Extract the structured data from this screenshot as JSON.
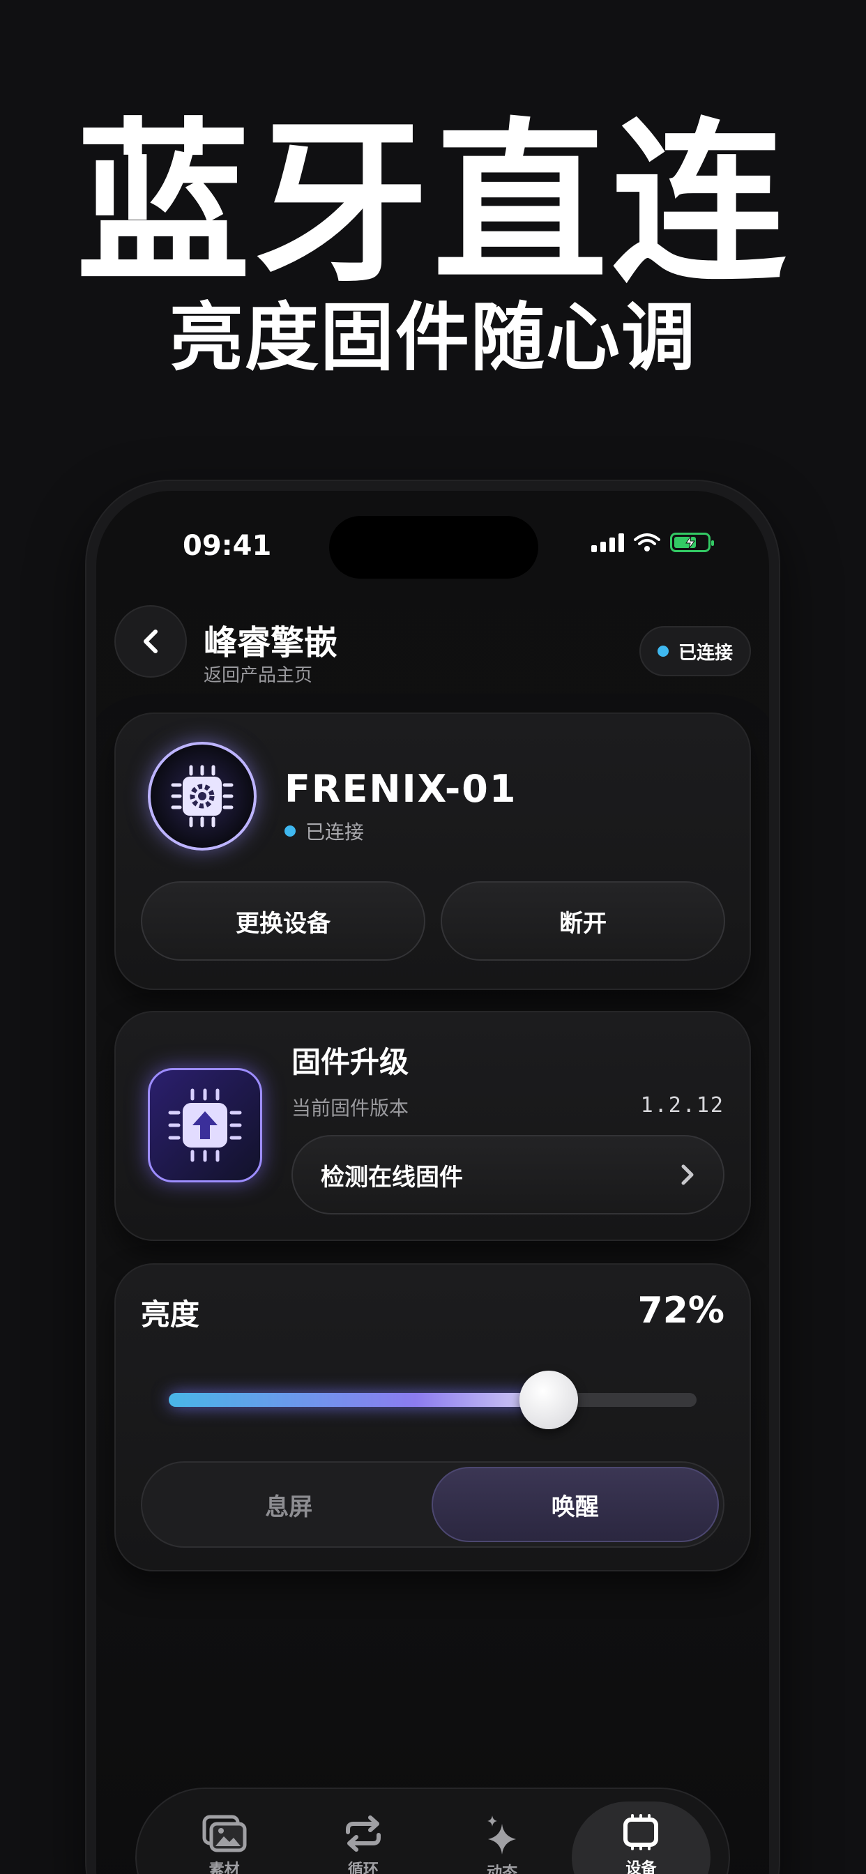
{
  "hero": {
    "title": "蓝牙直连",
    "subtitle": "亮度固件随心调"
  },
  "status_bar": {
    "time": "09:41"
  },
  "header": {
    "title": "峰睿擎嵌",
    "subtitle": "返回产品主页",
    "status": "已连接"
  },
  "device": {
    "name": "FRENIX-01",
    "status": "已连接",
    "switch_label": "更换设备",
    "disconnect_label": "断开"
  },
  "firmware": {
    "title": "固件升级",
    "current_label": "当前固件版本",
    "version": "1.2.12",
    "check_label": "检测在线固件"
  },
  "brightness": {
    "title": "亮度",
    "value_text": "72%",
    "value": 72,
    "modes": [
      "息屏",
      "唤醒"
    ],
    "active_mode": "唤醒"
  },
  "tabs": [
    {
      "label": "素材",
      "icon": "images-icon"
    },
    {
      "label": "循环",
      "icon": "repeat-icon"
    },
    {
      "label": "动态",
      "icon": "sparkle-icon"
    },
    {
      "label": "设备",
      "icon": "device-chip-icon",
      "active": true
    }
  ],
  "colors": {
    "accent_blue": "#3fb8f0",
    "accent_purple": "#8c7cf0",
    "battery": "#33c964"
  }
}
